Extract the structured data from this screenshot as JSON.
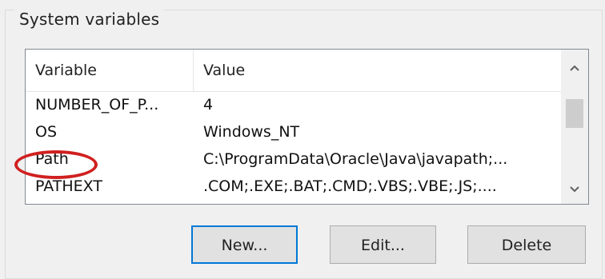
{
  "group": {
    "title": "System variables"
  },
  "table": {
    "columns": [
      "Variable",
      "Value"
    ],
    "rows": [
      {
        "variable": "NUMBER_OF_P...",
        "value": "4"
      },
      {
        "variable": "OS",
        "value": "Windows_NT"
      },
      {
        "variable": "Path",
        "value": "C:\\ProgramData\\Oracle\\Java\\javapath;..."
      },
      {
        "variable": "PATHEXT",
        "value": ".COM;.EXE;.BAT;.CMD;.VBS;.VBE;.JS;...."
      }
    ],
    "highlighted_row": "Path",
    "highlight_color": "#d0201f"
  },
  "scrollbar": {
    "up_icon": "chevron-up-icon",
    "down_icon": "chevron-down-icon"
  },
  "buttons": {
    "new": "New...",
    "edit": "Edit...",
    "delete": "Delete"
  }
}
